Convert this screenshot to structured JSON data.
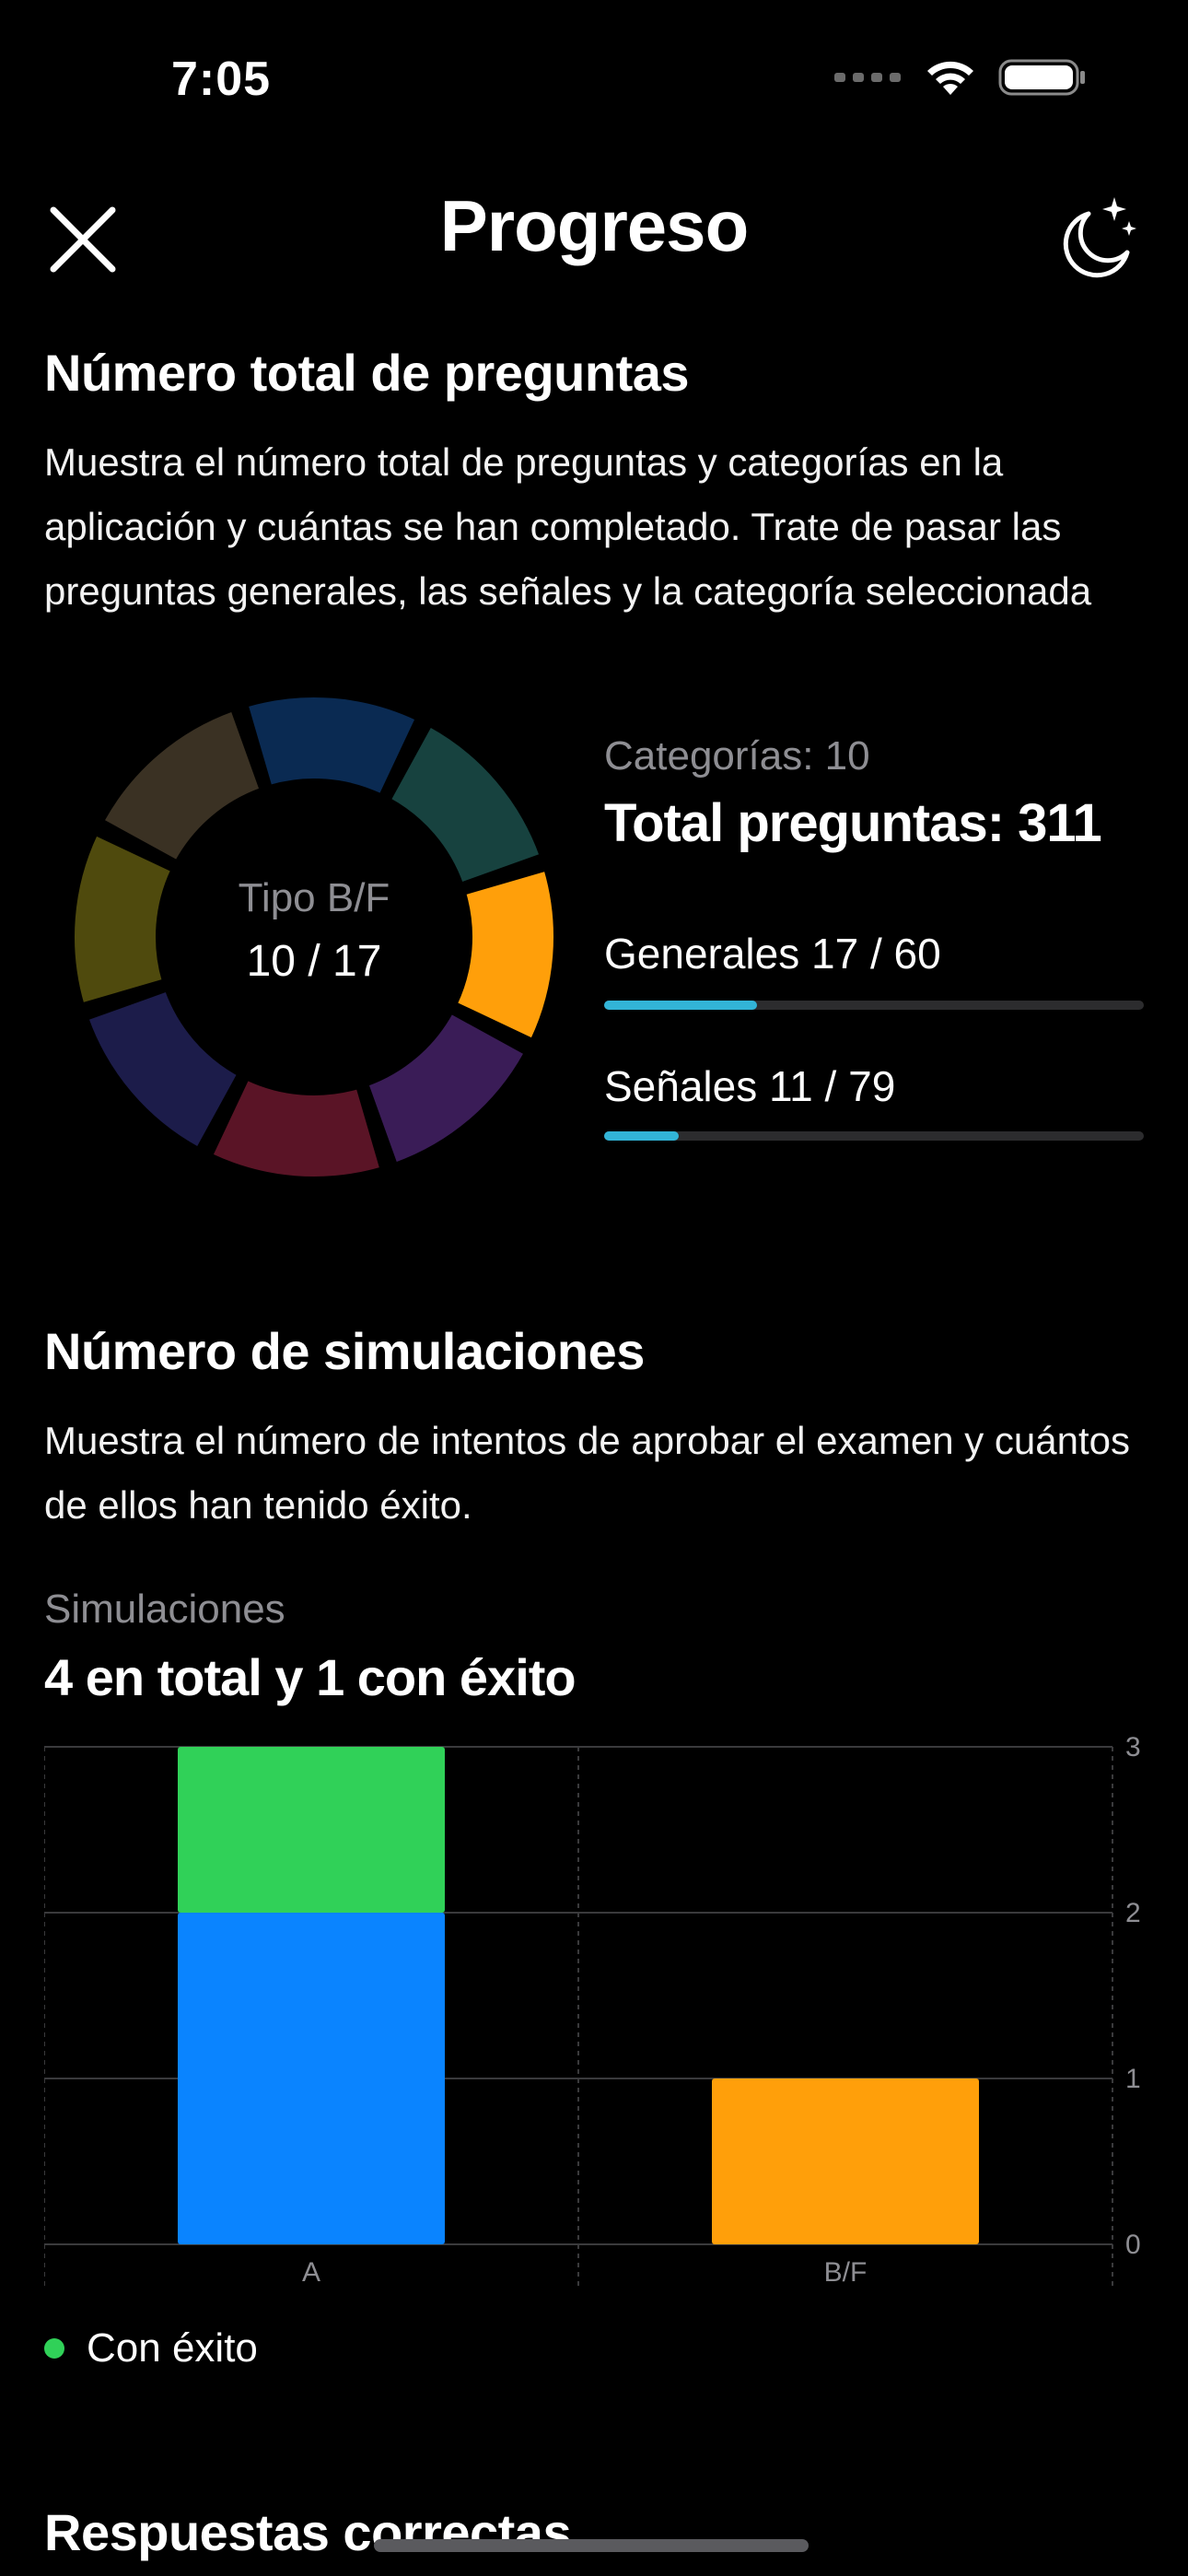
{
  "status_bar": {
    "time": "7:05"
  },
  "nav": {
    "title": "Progreso"
  },
  "section1": {
    "title": "Número total de preguntas",
    "description": "Muestra el número total de preguntas y categorías en la aplicación y cuántas se han completado. Trate de pasar las preguntas generales, las señales y la categoría seleccionada"
  },
  "donut": {
    "center_label": "Tipo B/F",
    "center_value": "10 / 17",
    "segment_colors": [
      "#0a2a52",
      "#17423f",
      "#ff9f0a",
      "#3a1c57",
      "#5a1426",
      "#1c1c4a",
      "#4f4a0d",
      "#3a3123"
    ],
    "highlighted_segment_color": "#ff9f0a"
  },
  "stats": {
    "categories_label": "Categorías: 10",
    "total_label": "Total preguntas: 311",
    "progress": [
      {
        "label": "Generales 17 / 60",
        "fraction": 0.283
      },
      {
        "label": "Señales 11 / 79",
        "fraction": 0.139
      }
    ],
    "bar_color": "#32b4d7"
  },
  "section2": {
    "title": "Número de simulaciones",
    "description": "Muestra el número de intentos de aprobar el examen y cuántos de ellos han tenido éxito.",
    "sim_label": "Simulaciones",
    "sim_summary": "4 en total y 1 con éxito"
  },
  "chart_data": {
    "type": "bar",
    "stacked": true,
    "categories": [
      "A",
      "B/F"
    ],
    "series": [
      {
        "name": "",
        "values": [
          2,
          0
        ],
        "color": "#0a84ff"
      },
      {
        "name": "Con éxito",
        "values": [
          1,
          0
        ],
        "color": "#30d158"
      },
      {
        "name": "",
        "values": [
          0,
          1
        ],
        "color": "#ff9f0a"
      }
    ],
    "ylim": [
      0,
      3
    ],
    "yticks": [
      "0",
      "1",
      "2",
      "3"
    ],
    "grid": true,
    "legend_position": "bottom-left"
  },
  "legend": {
    "label": "Con éxito"
  },
  "section3": {
    "title": "Respuestas correctas"
  }
}
